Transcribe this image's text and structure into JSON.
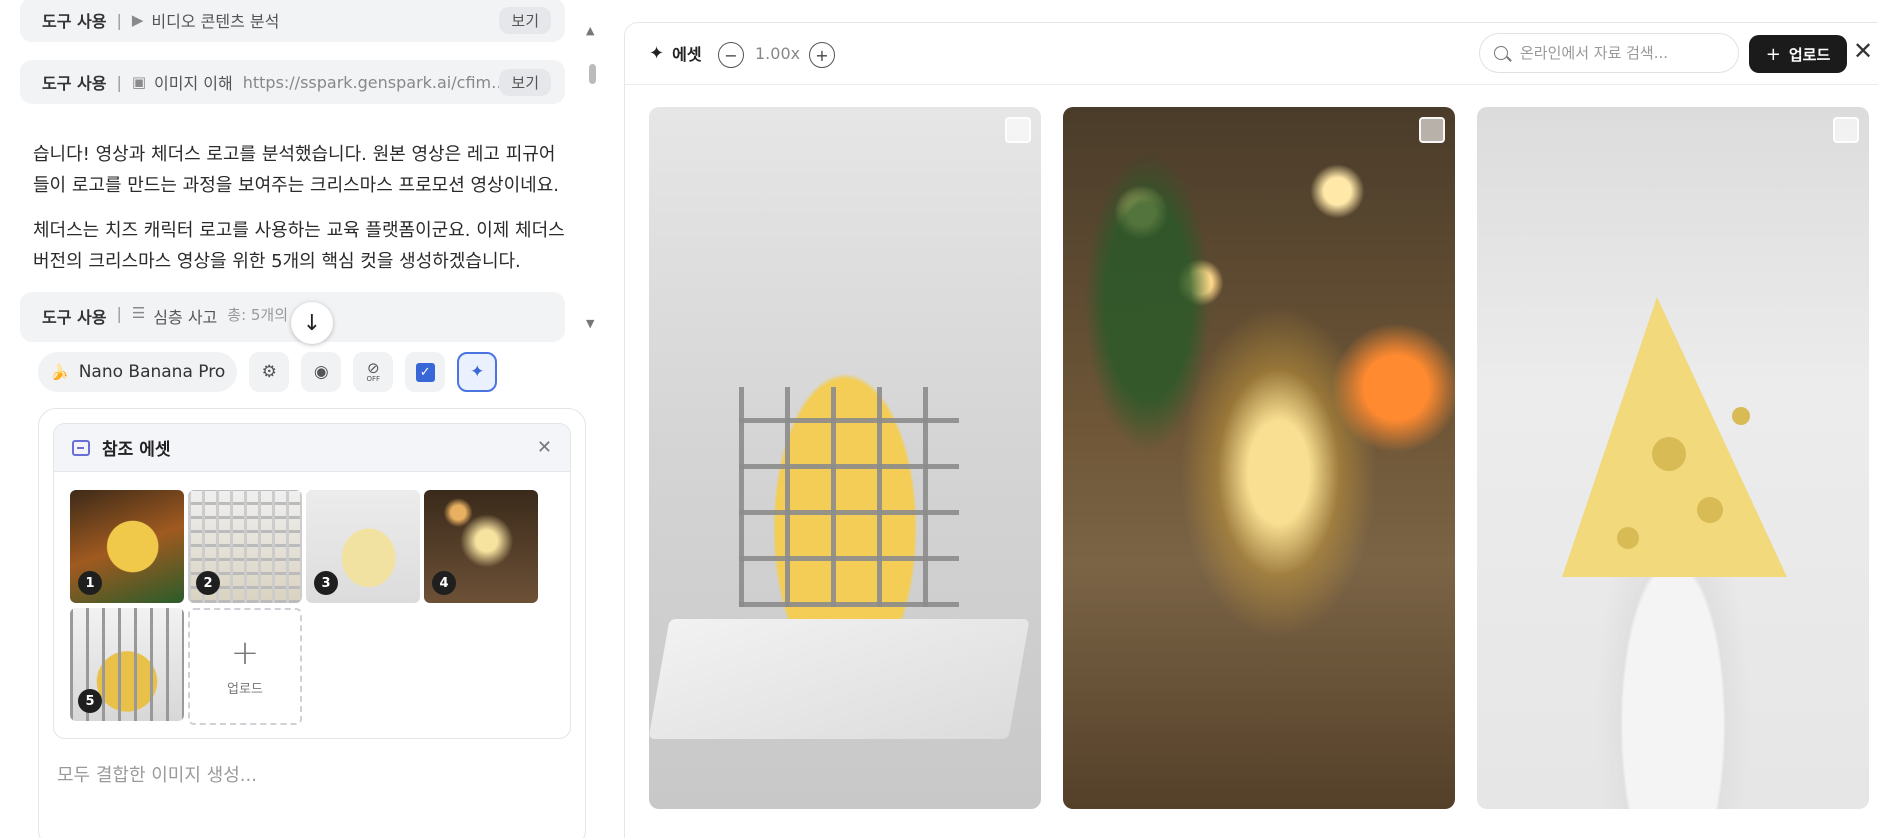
{
  "chat": {
    "tool_rows": [
      {
        "label": "도구 사용",
        "icon": "video-icon",
        "name": "비디오 콘텐츠 분석",
        "detail": "",
        "view": "보기"
      },
      {
        "label": "도구 사용",
        "icon": "image-icon",
        "name": "이미지 이해",
        "detail": "https://sspark.genspark.ai/cfim…",
        "view": "보기"
      },
      {
        "label": "도구 사용",
        "icon": "list-icon",
        "name": "심층 사고",
        "detail": "총: 5개의 ",
        "view": ""
      }
    ],
    "messages": [
      [
        "습니다! 영상과 체더스 로고를 분석했습니다. 원본 영상은 레고 피규어",
        "들이 로고를 만드는 과정을 보여주는 크리스마스 프로모션 영상이네요."
      ],
      [
        "체더스는 치즈 캐릭터 로고를 사용하는 교육 플랫폼이군요. 이제 체더스",
        "버전의 크리스마스 영상을 위한 5개의 핵심 컷을 생성하겠습니다."
      ]
    ]
  },
  "toolbar": {
    "model_icon": "banana-icon",
    "model_label": "Nano Banana Pro",
    "off_badge": "OFF"
  },
  "reference_assets": {
    "title": "참조 에셋",
    "thumbnails": [
      "1",
      "2",
      "3",
      "4",
      "5"
    ],
    "upload_label": "업로드"
  },
  "prompt": {
    "placeholder": "모두 결합한 이미지 생성..."
  },
  "asset_panel": {
    "title": "에셋",
    "zoom": "1.00x",
    "search_placeholder": "온라인에서 자료 검색...",
    "upload_label": "업로드",
    "cards": [
      "cheese-construction-scene",
      "glowing-cheese-christmas-scene",
      "cheese-wedge-on-pedestal"
    ]
  },
  "colors": {
    "accent": "#3a67d8",
    "upload_button": "#1b1b1b",
    "chip_bg": "#f1f2f4"
  }
}
